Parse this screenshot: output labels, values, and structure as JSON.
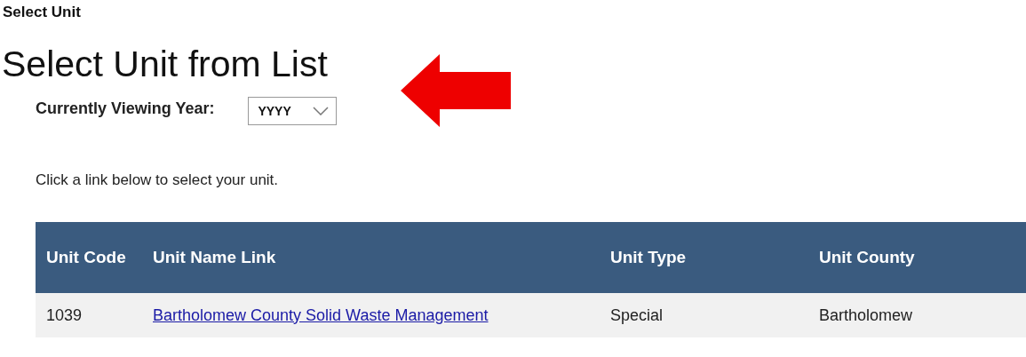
{
  "breadcrumb": "Select Unit",
  "heading": "Select Unit from List",
  "year_filter": {
    "label": "Currently Viewing Year:",
    "value": "YYYY"
  },
  "instruction": "Click a link below to select your unit.",
  "table": {
    "columns": [
      "Unit Code",
      "Unit Name Link",
      "Unit Type",
      "Unit County"
    ],
    "rows": [
      {
        "code": "1039",
        "name": "Bartholomew County Solid Waste Management",
        "type": "Special",
        "county": "Bartholomew"
      }
    ]
  }
}
